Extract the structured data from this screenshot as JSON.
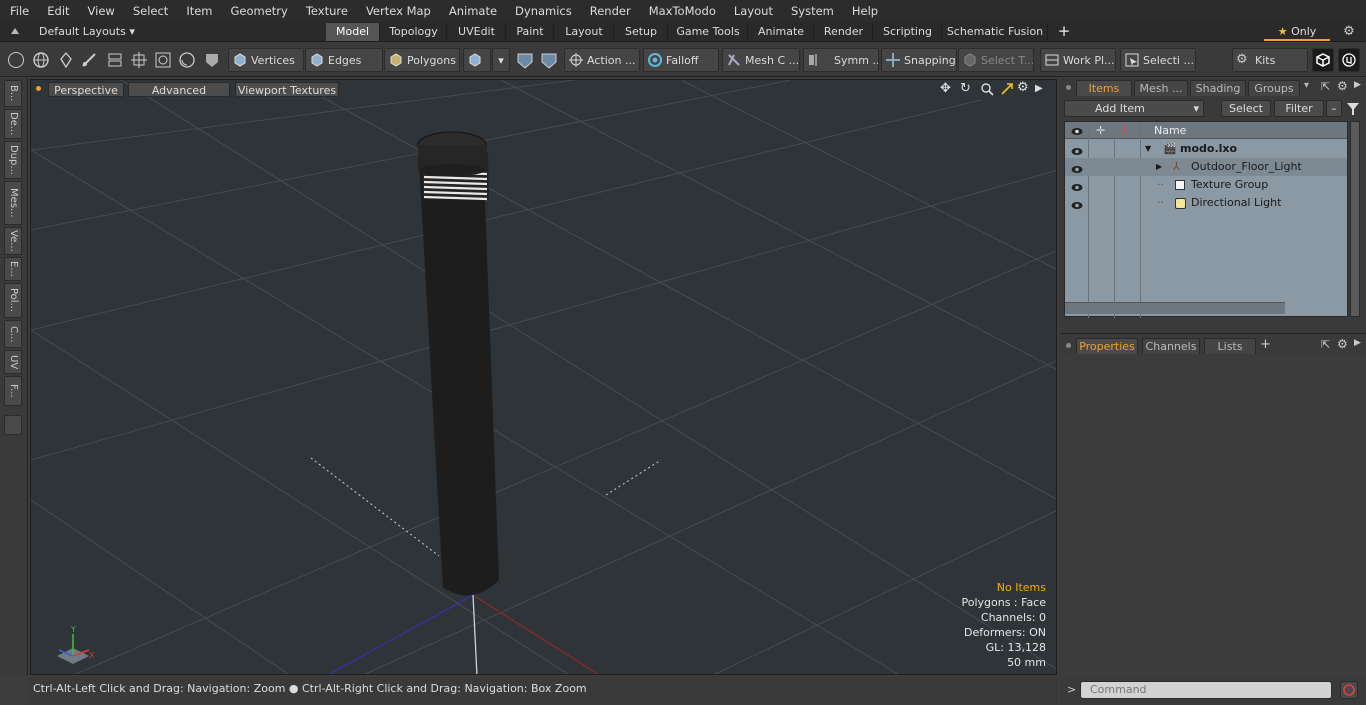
{
  "menu": [
    "File",
    "Edit",
    "View",
    "Select",
    "Item",
    "Geometry",
    "Texture",
    "Vertex Map",
    "Animate",
    "Dynamics",
    "Render",
    "MaxToModo",
    "Layout",
    "System",
    "Help"
  ],
  "layout_bar": {
    "layouts_label": "Default Layouts",
    "tabs": [
      "Model",
      "Topology",
      "UVEdit",
      "Paint",
      "Layout",
      "Setup",
      "Game Tools",
      "Animate",
      "Render",
      "Scripting",
      "Schematic Fusion"
    ],
    "active_tab": "Model",
    "add_tab": "+",
    "only_label": "Only"
  },
  "toolbar": {
    "vertices": "Vertices",
    "edges": "Edges",
    "polygons": "Polygons",
    "action": "Action ...",
    "falloff": "Falloff",
    "mesh": "Mesh C ...",
    "symmetry": "Symm ...",
    "snapping": "Snapping",
    "select_tool": "Select T...",
    "work_plane": "Work Pl...",
    "selection": "Selecti ...",
    "kits": "Kits"
  },
  "left_tabs": [
    "B...",
    "De...",
    "Dup...",
    "Mes...",
    "Ve...",
    "E...",
    "Pol...",
    "C...",
    "UV",
    "F..."
  ],
  "viewport": {
    "buttons": [
      "Perspective",
      "Advanced",
      "Viewport Textures"
    ],
    "info": {
      "selection": "No Items",
      "polygons": "Polygons : Face",
      "channels": "Channels: 0",
      "deformers": "Deformers: ON",
      "gl": "GL: 13,128",
      "units": "50 mm"
    },
    "axes": {
      "y": "Y",
      "x": "X"
    }
  },
  "status": {
    "text": "Ctrl-Alt-Left Click and Drag: Navigation: Zoom ● Ctrl-Alt-Right Click and Drag: Navigation: Box Zoom"
  },
  "items_panel": {
    "tabs": [
      "Items",
      "Mesh ...",
      "Shading",
      "Groups"
    ],
    "active_tab": "Items",
    "add_item": "Add Item",
    "select": "Select",
    "filter": "Filter",
    "column_name": "Name",
    "tree": [
      {
        "label": "modo.lxo",
        "bold": true
      },
      {
        "label": "Outdoor_Floor_Light"
      },
      {
        "label": "Texture Group"
      },
      {
        "label": "Directional Light"
      }
    ]
  },
  "properties_panel": {
    "tabs": [
      "Properties",
      "Channels",
      "Lists"
    ],
    "active_tab": "Properties",
    "add_tab": "+"
  },
  "command": {
    "placeholder": "Command",
    "prompt": ">"
  },
  "colors": {
    "accent": "#f0a030",
    "viewport_bg": "#2e3438",
    "info_warn": "#f0b000"
  }
}
